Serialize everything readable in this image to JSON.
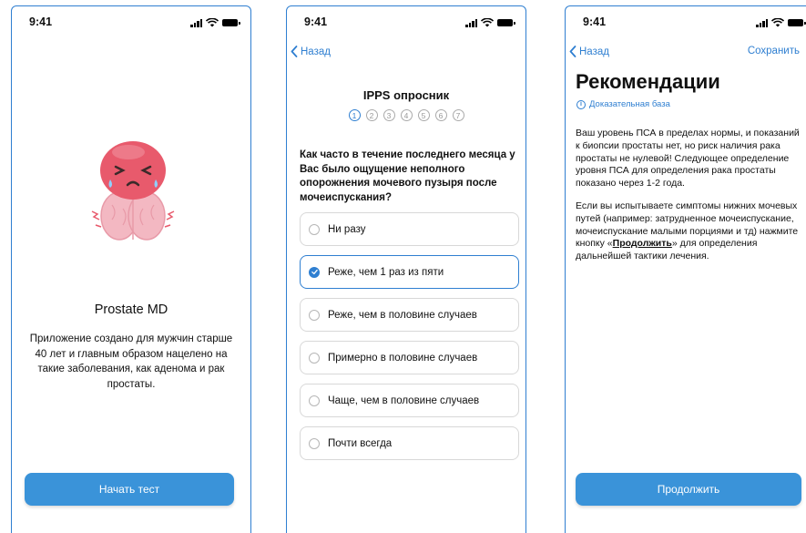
{
  "screens": {
    "welcome": {
      "status_time": "9:41",
      "title": "Prostate MD",
      "description": "Приложение создано для мужчин старше 40 лет и главным образом нацелено на такие заболевания, как аденома и рак простаты.",
      "start_button": "Начать тест",
      "mascot_icon": "sad-prostate-mascot-icon"
    },
    "survey": {
      "status_time": "9:41",
      "back_label": "Назад",
      "title": "IPPS опросник",
      "steps": [
        "1",
        "2",
        "3",
        "4",
        "5",
        "6",
        "7"
      ],
      "active_step": "1",
      "question": "Как часто в течение последнего месяца у Вас было ощущение неполного опорожнения мочевого пузыря после мочеиспускания?",
      "options": [
        {
          "label": "Ни разу",
          "selected": false
        },
        {
          "label": "Реже, чем 1 раз из пяти",
          "selected": true
        },
        {
          "label": "Реже, чем в половине случаев",
          "selected": false
        },
        {
          "label": "Примерно в половине случаев",
          "selected": false
        },
        {
          "label": "Чаще, чем в половине случаев",
          "selected": false
        },
        {
          "label": "Почти всегда",
          "selected": false
        }
      ]
    },
    "recommendations": {
      "status_time": "9:41",
      "back_label": "Назад",
      "save_label": "Сохранить",
      "title": "Рекомендации",
      "evidence_link": "Доказательная база",
      "paragraph1": "Ваш уровень ПСА в пределах нормы, и показаний к биопсии простаты нет, но риск наличия рака простаты не нулевой! Следующее определение уровня ПСА для определения рака простаты показано через 1-2 года.",
      "paragraph2_before": "Если вы испытываете симптомы нижних мочевых путей (например: затрудненное мочеиспускание, мочеиспускание малыми порциями и тд) нажмите кнопку «",
      "paragraph2_link": "Продолжить",
      "paragraph2_after": "» для определения дальнейшей тактики лечения.",
      "continue_button": "Продолжить"
    }
  },
  "colors": {
    "accent": "#2f7fd1",
    "button": "#3a93d9",
    "mascot_head": "#e85a6c",
    "mascot_gland": "#f3b8c2"
  }
}
